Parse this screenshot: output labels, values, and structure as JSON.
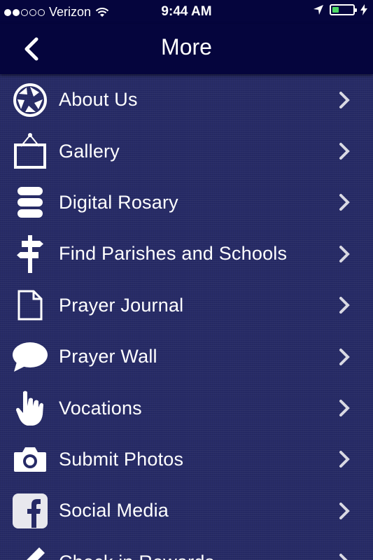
{
  "status_bar": {
    "carrier": "Verizon",
    "time": "9:44 AM",
    "signal_bars": 2,
    "battery_level": 0.2
  },
  "header": {
    "title": "More",
    "back_icon": "chevron-left-icon"
  },
  "menu": {
    "items": [
      {
        "label": "About Us",
        "icon": "aperture-icon"
      },
      {
        "label": "Gallery",
        "icon": "picture-frame-icon"
      },
      {
        "label": "Digital Rosary",
        "icon": "database-stack-icon"
      },
      {
        "label": "Find Parishes and Schools",
        "icon": "signpost-icon"
      },
      {
        "label": "Prayer Journal",
        "icon": "document-icon"
      },
      {
        "label": "Prayer Wall",
        "icon": "speech-bubble-icon"
      },
      {
        "label": "Vocations",
        "icon": "hand-pointer-icon"
      },
      {
        "label": "Submit Photos",
        "icon": "camera-icon"
      },
      {
        "label": "Social Media",
        "icon": "facebook-icon"
      },
      {
        "label": "Check in Rewards",
        "icon": "pencil-icon"
      }
    ]
  },
  "colors": {
    "navbar_bg": "#05053d",
    "list_bg": "#262a66",
    "battery_fill": "#4cd964"
  }
}
